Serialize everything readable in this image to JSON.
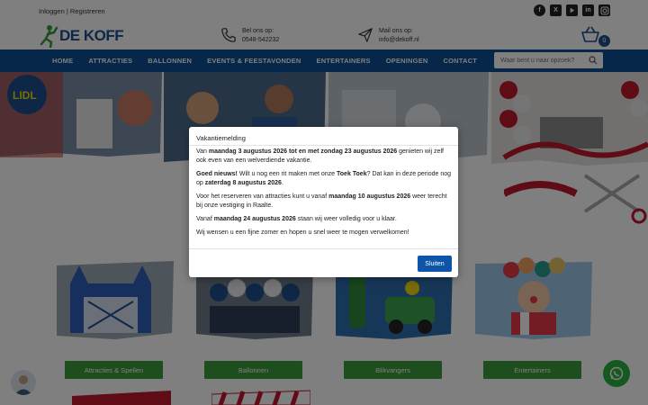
{
  "topbar": {
    "login": "Inloggen",
    "separator": " | ",
    "register": "Registreren"
  },
  "social": [
    "facebook-icon",
    "x-icon",
    "youtube-icon",
    "linkedin-icon",
    "instagram-icon"
  ],
  "header": {
    "logo_text": "DE KOFF",
    "phone_label": "Bel ons op:",
    "phone_number": "0548-542232",
    "mail_label": "Mail ons op:",
    "mail_address": "info@dekoff.nl",
    "cart_count": "0"
  },
  "nav": {
    "items": [
      "HOME",
      "ATTRACTIES",
      "BALLONNEN",
      "EVENTS & FEESTAVONDEN",
      "ENTERTAINERS",
      "OPENINGEN",
      "CONTACT"
    ],
    "search_placeholder": "Waar bent u naar opzoek?"
  },
  "cards": [
    {
      "label": "Attracties & Spellen"
    },
    {
      "label": "Ballonnen"
    },
    {
      "label": "Blikvangers"
    },
    {
      "label": "Entertainers"
    }
  ],
  "modal": {
    "title": "Vakantiemelding",
    "p1_a": "Van ",
    "p1_b": "maandag 3 augustus 2026 tot en met zondag 23 augustus 2026",
    "p1_c": " genieten wij zelf ook even van een welverdiende vakantie.",
    "p2_a": "Goed nieuws!",
    "p2_b": " Wilt u nog een rit maken met onze ",
    "p2_c": "Toek Toek",
    "p2_d": "? Dat kan in deze periode nog op ",
    "p2_e": "zaterdag 8 augustus 2026",
    "p2_f": ".",
    "p3_a": "Voor het reserveren van attracties kunt u vanaf ",
    "p3_b": "maandag 10 augustus 2026",
    "p3_c": " weer terecht bij onze vestiging in Raalte.",
    "p4_a": "Vanaf ",
    "p4_b": "maandag 24 augustus 2026",
    "p4_c": " staan wij weer volledig voor u klaar.",
    "p5": "Wij wensen u een fijne zomer en hopen u snel weer te mogen verwelkomen!",
    "close_label": "Sluiten"
  },
  "colors": {
    "nav": "#0d4f93",
    "button_green": "#3c9a3c",
    "modal_button": "#0d55a8",
    "whatsapp": "#2bb241"
  }
}
